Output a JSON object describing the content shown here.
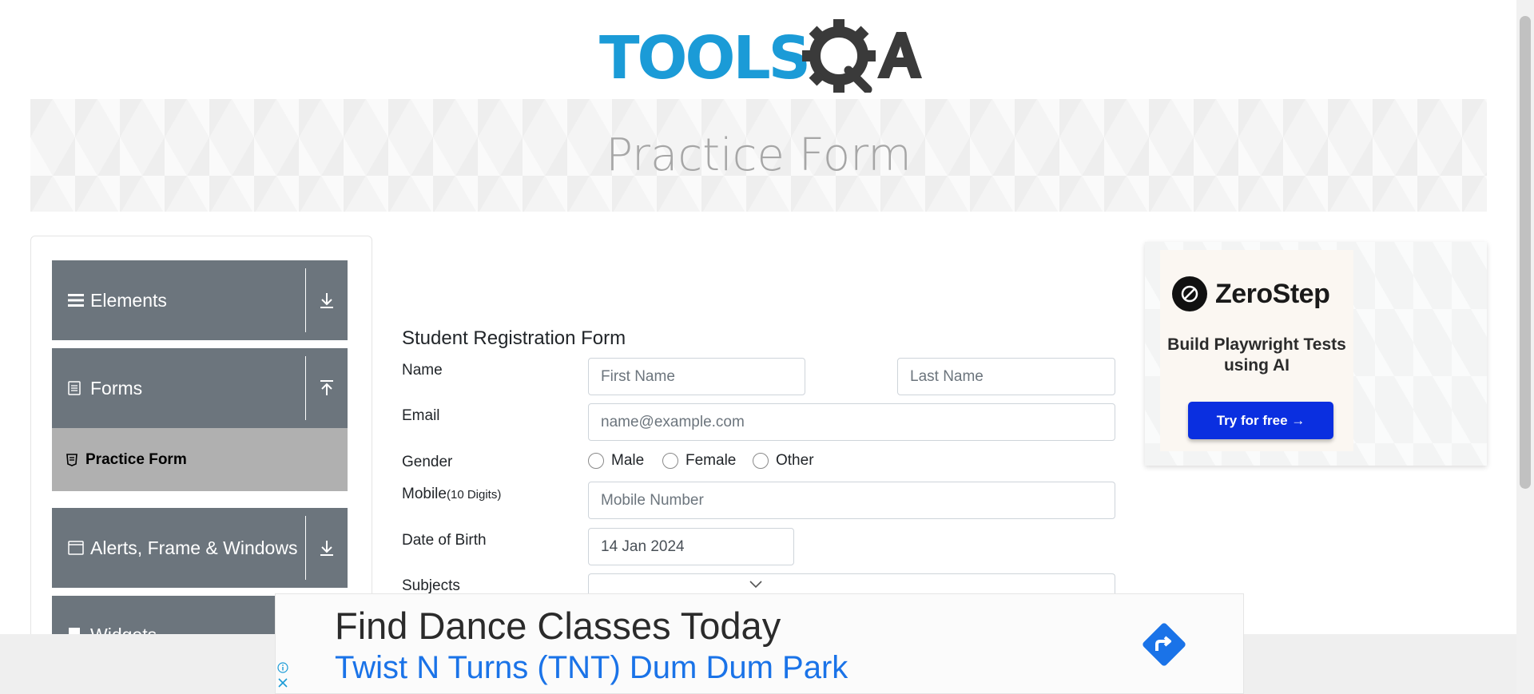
{
  "header": {
    "logo_text": "TOOLSQA"
  },
  "banner": {
    "title": "Practice Form"
  },
  "sidebar": {
    "groups": [
      {
        "label": "Elements",
        "icon": "hamburger-icon",
        "toggle": "download-arrow-icon"
      },
      {
        "label": "Forms",
        "icon": "document-icon",
        "toggle": "upload-arrow-icon"
      },
      {
        "label": "Alerts, Frame & Windows",
        "icon": "window-icon",
        "toggle": "download-arrow-icon"
      },
      {
        "label": "Widgets",
        "icon": "widgets-icon"
      }
    ],
    "active_item": {
      "label": "Practice Form",
      "icon": "form-icon"
    }
  },
  "form": {
    "title": "Student Registration Form",
    "name_label": "Name",
    "first_name_placeholder": "First Name",
    "last_name_placeholder": "Last Name",
    "email_label": "Email",
    "email_placeholder": "name@example.com",
    "gender_label": "Gender",
    "gender_options": [
      "Male",
      "Female",
      "Other"
    ],
    "mobile_label": "Mobile",
    "mobile_hint": "(10 Digits)",
    "mobile_placeholder": "Mobile Number",
    "dob_label": "Date of Birth",
    "dob_value": "14 Jan 2024",
    "subjects_label": "Subjects"
  },
  "side_ad": {
    "brand": "ZeroStep",
    "tagline": "Build Playwright Tests using AI",
    "button": "Try for free →"
  },
  "bottom_ad": {
    "headline": "Find Dance Classes Today",
    "subline": "Twist N Turns (TNT) Dum Dum Park"
  }
}
